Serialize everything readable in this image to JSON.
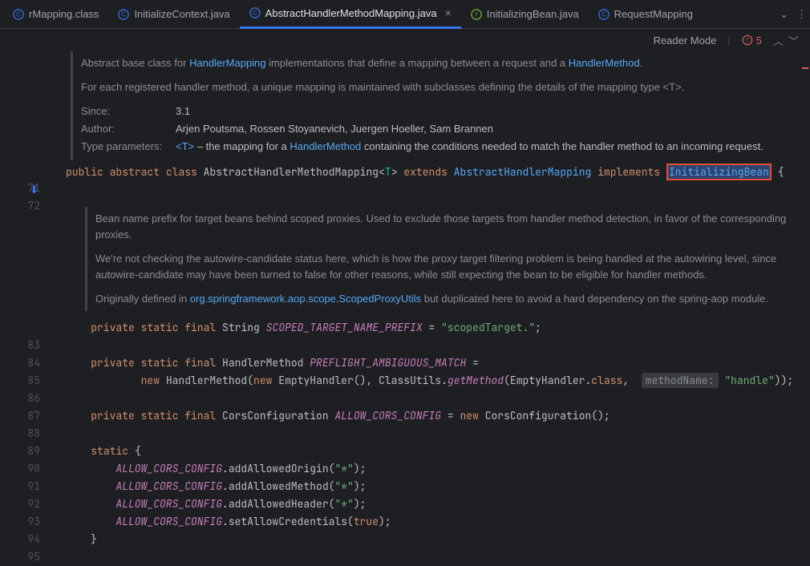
{
  "tabs": [
    {
      "label": "rMapping.class",
      "icon": "class-icon",
      "color": "#3574f0"
    },
    {
      "label": "InitializeContext.java",
      "icon": "class-icon",
      "color": "#3574f0"
    },
    {
      "label": "AbstractHandlerMethodMapping.java",
      "icon": "class-icon",
      "color": "#3574f0",
      "active": true,
      "closeable": true
    },
    {
      "label": "InitializingBean.java",
      "icon": "interface-icon",
      "color": "#6fb536"
    },
    {
      "label": "RequestMapping",
      "icon": "class-icon",
      "color": "#3574f0"
    }
  ],
  "toolbar": {
    "reader_mode": "Reader Mode",
    "error_count": "5"
  },
  "doc1": {
    "line1a": "Abstract base class for ",
    "line1link": "HandlerMapping",
    "line1b": " implementations that define a mapping between a request and a ",
    "line1link2": "HandlerMethod",
    "line1c": ".",
    "line2": "For each registered handler method, a unique mapping is maintained with subclasses defining the details of the mapping type <T>.",
    "since_label": "Since:",
    "since_val": "3.1",
    "author_label": "Author:",
    "author_val": "Arjen Poutsma, Rossen Stoyanevich, Juergen Hoeller, Sam Brannen",
    "tp_label": "Type parameters:",
    "tp_a": "<T>",
    "tp_b": " – the mapping for a ",
    "tp_link": "HandlerMethod",
    "tp_c": " containing the conditions needed to match the handler method to an incoming request."
  },
  "code": {
    "l71": {
      "public": "public",
      "abstract": "abstract",
      "class": "class",
      "name": "AbstractHandlerMethodMapping",
      "generic": "T",
      "extends": "extends",
      "super": "AbstractHandlerMapping",
      "implements": "implements",
      "iface": "InitializingBean",
      "brace": "{"
    }
  },
  "doc2": {
    "p1": "Bean name prefix for target beans behind scoped proxies. Used to exclude those targets from handler method detection, in favor of the corresponding proxies.",
    "p2": "We're not checking the autowire-candidate status here, which is how the proxy target filtering problem is being handled at the autowiring level, since autowire-candidate may have been turned to false for other reasons, while still expecting the bean to be eligible for handler methods.",
    "p3a": "Originally defined in ",
    "p3link": "org.springframework.aop.scope.ScopedProxyUtils",
    "p3b": " but duplicated here to avoid a hard dependency on the spring-aop module."
  },
  "lines": {
    "l83": {
      "mods": "private static final",
      "type": "String",
      "name": "SCOPED_TARGET_NAME_PREFIX",
      "eq": " = ",
      "val": "\"scopedTarget.\"",
      "end": ";"
    },
    "l85": {
      "mods": "private static final",
      "type": "HandlerMethod",
      "name": "PREFLIGHT_AMBIGUOUS_MATCH",
      "eq": " ="
    },
    "l86": {
      "new1": "new",
      "ctor1": "HandlerMethod",
      "p1": "(",
      "new2": "new",
      "ctor2": "EmptyHandler",
      "p2": "(), ClassUtils.",
      "m": "getMethod",
      "p3": "(EmptyHandler.",
      "cls": "class",
      "p4": ", ",
      "hint": "methodName:",
      "val": "\"handle\"",
      "end": "));"
    },
    "l88": {
      "mods": "private static final",
      "type": "CorsConfiguration",
      "name": "ALLOW_CORS_CONFIG",
      "eq": " = ",
      "new": "new",
      "ctor": "CorsConfiguration",
      "end": "();"
    },
    "l90": {
      "kw": "static",
      "brace": " {"
    },
    "l91": {
      "name": "ALLOW_CORS_CONFIG",
      "call": ".addAllowedOrigin(",
      "arg": "\"*\"",
      "end": ");"
    },
    "l92": {
      "name": "ALLOW_CORS_CONFIG",
      "call": ".addAllowedMethod(",
      "arg": "\"*\"",
      "end": ");"
    },
    "l93": {
      "name": "ALLOW_CORS_CONFIG",
      "call": ".addAllowedHeader(",
      "arg": "\"*\"",
      "end": ");"
    },
    "l94": {
      "name": "ALLOW_CORS_CONFIG",
      "call": ".setAllowCredentials(",
      "arg": "true",
      "end": ");"
    },
    "l95": {
      "brace": "}"
    }
  },
  "gutter": [
    "71",
    "72",
    "",
    "",
    "",
    "",
    "",
    "",
    "83",
    "84",
    "85",
    "86",
    "87",
    "88",
    "89",
    "90",
    "91",
    "92",
    "93",
    "94",
    "95"
  ]
}
